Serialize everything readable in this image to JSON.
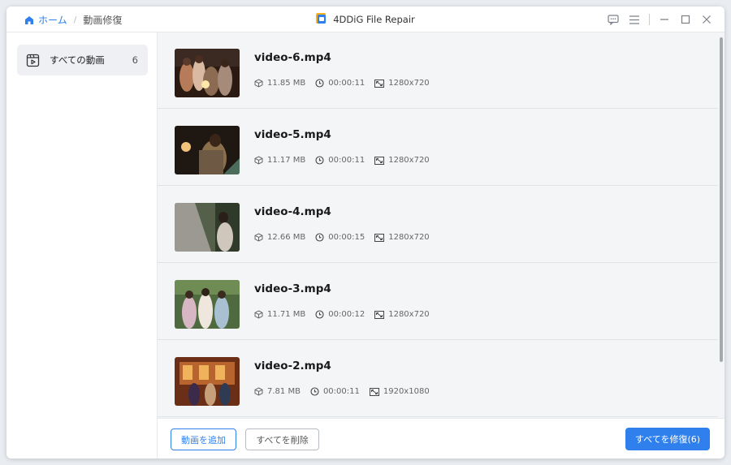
{
  "breadcrumb": {
    "home": "ホーム",
    "current": "動画修復"
  },
  "app": {
    "title": "4DDiG File Repair"
  },
  "sidebar": {
    "items": [
      {
        "label": "すべての動画",
        "count": "6",
        "icon": "video-folder-icon"
      }
    ]
  },
  "files": [
    {
      "name": "video-6.mp4",
      "size": "11.85 MB",
      "duration": "00:00:11",
      "resolution": "1280x720"
    },
    {
      "name": "video-5.mp4",
      "size": "11.17 MB",
      "duration": "00:00:11",
      "resolution": "1280x720"
    },
    {
      "name": "video-4.mp4",
      "size": "12.66 MB",
      "duration": "00:00:15",
      "resolution": "1280x720"
    },
    {
      "name": "video-3.mp4",
      "size": "11.71 MB",
      "duration": "00:00:12",
      "resolution": "1280x720"
    },
    {
      "name": "video-2.mp4",
      "size": "7.81 MB",
      "duration": "00:00:11",
      "resolution": "1920x1080"
    }
  ],
  "footer": {
    "add_label": "動画を追加",
    "delete_label": "すべてを削除",
    "repair_label": "すべてを修復(6)"
  },
  "colors": {
    "accent": "#2f80ed",
    "sidebar_selected": "#eef0f4",
    "list_bg": "#f4f5f7"
  },
  "icons": {
    "home": "home-icon",
    "feedback": "feedback-icon",
    "menu": "menu-icon",
    "minimize": "minimize-icon",
    "maximize": "maximize-icon",
    "close": "close-icon",
    "size": "box-icon",
    "duration": "clock-icon",
    "resolution": "resolution-icon"
  }
}
